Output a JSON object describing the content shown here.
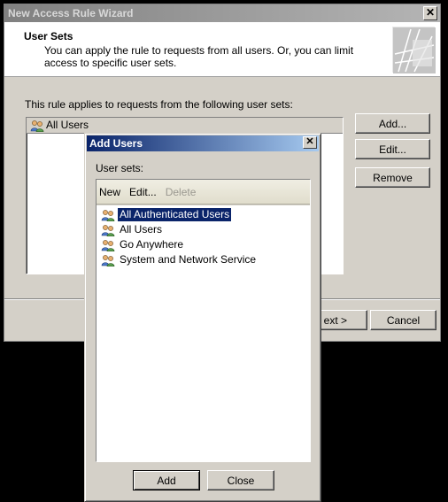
{
  "wizard": {
    "title": "New Access Rule Wizard",
    "close_glyph": "✕",
    "header_title": "User Sets",
    "header_subtitle": "You can apply the rule to requests from all users. Or, you can limit access to specific user sets.",
    "applies_label": "This rule applies to requests from the following user sets:",
    "user_sets": [
      {
        "label": "All Users",
        "icon": "users-icon"
      }
    ],
    "buttons": {
      "add": "Add...",
      "edit": "Edit...",
      "remove": "Remove",
      "next": "ext >",
      "cancel": "Cancel"
    }
  },
  "add_users_dialog": {
    "title": "Add Users",
    "close_glyph": "✕",
    "sets_label": "User sets:",
    "toolbar": {
      "new": "New",
      "edit": "Edit...",
      "delete": "Delete"
    },
    "items": [
      {
        "label": "All Authenticated Users",
        "icon": "users-icon",
        "selected": true
      },
      {
        "label": "All Users",
        "icon": "users-icon",
        "selected": false
      },
      {
        "label": "Go Anywhere",
        "icon": "users-icon",
        "selected": false
      },
      {
        "label": "System and Network Service",
        "icon": "users-icon",
        "selected": false
      }
    ],
    "buttons": {
      "add": "Add",
      "close": "Close"
    }
  },
  "colors": {
    "title_active_start": "#0a246a",
    "title_active_end": "#a6caf0",
    "selection": "#0a246a",
    "dialog_face": "#d4d0c8"
  }
}
